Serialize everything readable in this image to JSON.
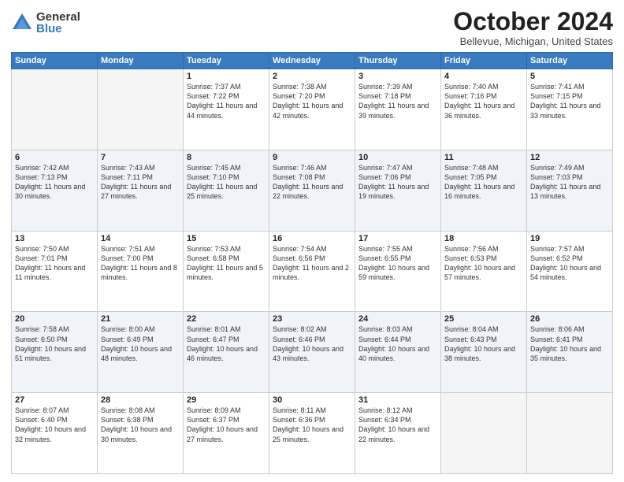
{
  "logo": {
    "general": "General",
    "blue": "Blue"
  },
  "title": "October 2024",
  "location": "Bellevue, Michigan, United States",
  "days_of_week": [
    "Sunday",
    "Monday",
    "Tuesday",
    "Wednesday",
    "Thursday",
    "Friday",
    "Saturday"
  ],
  "weeks": [
    [
      {
        "day": "",
        "empty": true
      },
      {
        "day": "",
        "empty": true
      },
      {
        "day": "1",
        "sunrise": "7:37 AM",
        "sunset": "7:22 PM",
        "daylight": "11 hours and 44 minutes."
      },
      {
        "day": "2",
        "sunrise": "7:38 AM",
        "sunset": "7:20 PM",
        "daylight": "11 hours and 42 minutes."
      },
      {
        "day": "3",
        "sunrise": "7:39 AM",
        "sunset": "7:18 PM",
        "daylight": "11 hours and 39 minutes."
      },
      {
        "day": "4",
        "sunrise": "7:40 AM",
        "sunset": "7:16 PM",
        "daylight": "11 hours and 36 minutes."
      },
      {
        "day": "5",
        "sunrise": "7:41 AM",
        "sunset": "7:15 PM",
        "daylight": "11 hours and 33 minutes."
      }
    ],
    [
      {
        "day": "6",
        "sunrise": "7:42 AM",
        "sunset": "7:13 PM",
        "daylight": "11 hours and 30 minutes."
      },
      {
        "day": "7",
        "sunrise": "7:43 AM",
        "sunset": "7:11 PM",
        "daylight": "11 hours and 27 minutes."
      },
      {
        "day": "8",
        "sunrise": "7:45 AM",
        "sunset": "7:10 PM",
        "daylight": "11 hours and 25 minutes."
      },
      {
        "day": "9",
        "sunrise": "7:46 AM",
        "sunset": "7:08 PM",
        "daylight": "11 hours and 22 minutes."
      },
      {
        "day": "10",
        "sunrise": "7:47 AM",
        "sunset": "7:06 PM",
        "daylight": "11 hours and 19 minutes."
      },
      {
        "day": "11",
        "sunrise": "7:48 AM",
        "sunset": "7:05 PM",
        "daylight": "11 hours and 16 minutes."
      },
      {
        "day": "12",
        "sunrise": "7:49 AM",
        "sunset": "7:03 PM",
        "daylight": "11 hours and 13 minutes."
      }
    ],
    [
      {
        "day": "13",
        "sunrise": "7:50 AM",
        "sunset": "7:01 PM",
        "daylight": "11 hours and 11 minutes."
      },
      {
        "day": "14",
        "sunrise": "7:51 AM",
        "sunset": "7:00 PM",
        "daylight": "11 hours and 8 minutes."
      },
      {
        "day": "15",
        "sunrise": "7:53 AM",
        "sunset": "6:58 PM",
        "daylight": "11 hours and 5 minutes."
      },
      {
        "day": "16",
        "sunrise": "7:54 AM",
        "sunset": "6:56 PM",
        "daylight": "11 hours and 2 minutes."
      },
      {
        "day": "17",
        "sunrise": "7:55 AM",
        "sunset": "6:55 PM",
        "daylight": "10 hours and 59 minutes."
      },
      {
        "day": "18",
        "sunrise": "7:56 AM",
        "sunset": "6:53 PM",
        "daylight": "10 hours and 57 minutes."
      },
      {
        "day": "19",
        "sunrise": "7:57 AM",
        "sunset": "6:52 PM",
        "daylight": "10 hours and 54 minutes."
      }
    ],
    [
      {
        "day": "20",
        "sunrise": "7:58 AM",
        "sunset": "6:50 PM",
        "daylight": "10 hours and 51 minutes."
      },
      {
        "day": "21",
        "sunrise": "8:00 AM",
        "sunset": "6:49 PM",
        "daylight": "10 hours and 48 minutes."
      },
      {
        "day": "22",
        "sunrise": "8:01 AM",
        "sunset": "6:47 PM",
        "daylight": "10 hours and 46 minutes."
      },
      {
        "day": "23",
        "sunrise": "8:02 AM",
        "sunset": "6:46 PM",
        "daylight": "10 hours and 43 minutes."
      },
      {
        "day": "24",
        "sunrise": "8:03 AM",
        "sunset": "6:44 PM",
        "daylight": "10 hours and 40 minutes."
      },
      {
        "day": "25",
        "sunrise": "8:04 AM",
        "sunset": "6:43 PM",
        "daylight": "10 hours and 38 minutes."
      },
      {
        "day": "26",
        "sunrise": "8:06 AM",
        "sunset": "6:41 PM",
        "daylight": "10 hours and 35 minutes."
      }
    ],
    [
      {
        "day": "27",
        "sunrise": "8:07 AM",
        "sunset": "6:40 PM",
        "daylight": "10 hours and 32 minutes."
      },
      {
        "day": "28",
        "sunrise": "8:08 AM",
        "sunset": "6:38 PM",
        "daylight": "10 hours and 30 minutes."
      },
      {
        "day": "29",
        "sunrise": "8:09 AM",
        "sunset": "6:37 PM",
        "daylight": "10 hours and 27 minutes."
      },
      {
        "day": "30",
        "sunrise": "8:11 AM",
        "sunset": "6:36 PM",
        "daylight": "10 hours and 25 minutes."
      },
      {
        "day": "31",
        "sunrise": "8:12 AM",
        "sunset": "6:34 PM",
        "daylight": "10 hours and 22 minutes."
      },
      {
        "day": "",
        "empty": true
      },
      {
        "day": "",
        "empty": true
      }
    ]
  ]
}
